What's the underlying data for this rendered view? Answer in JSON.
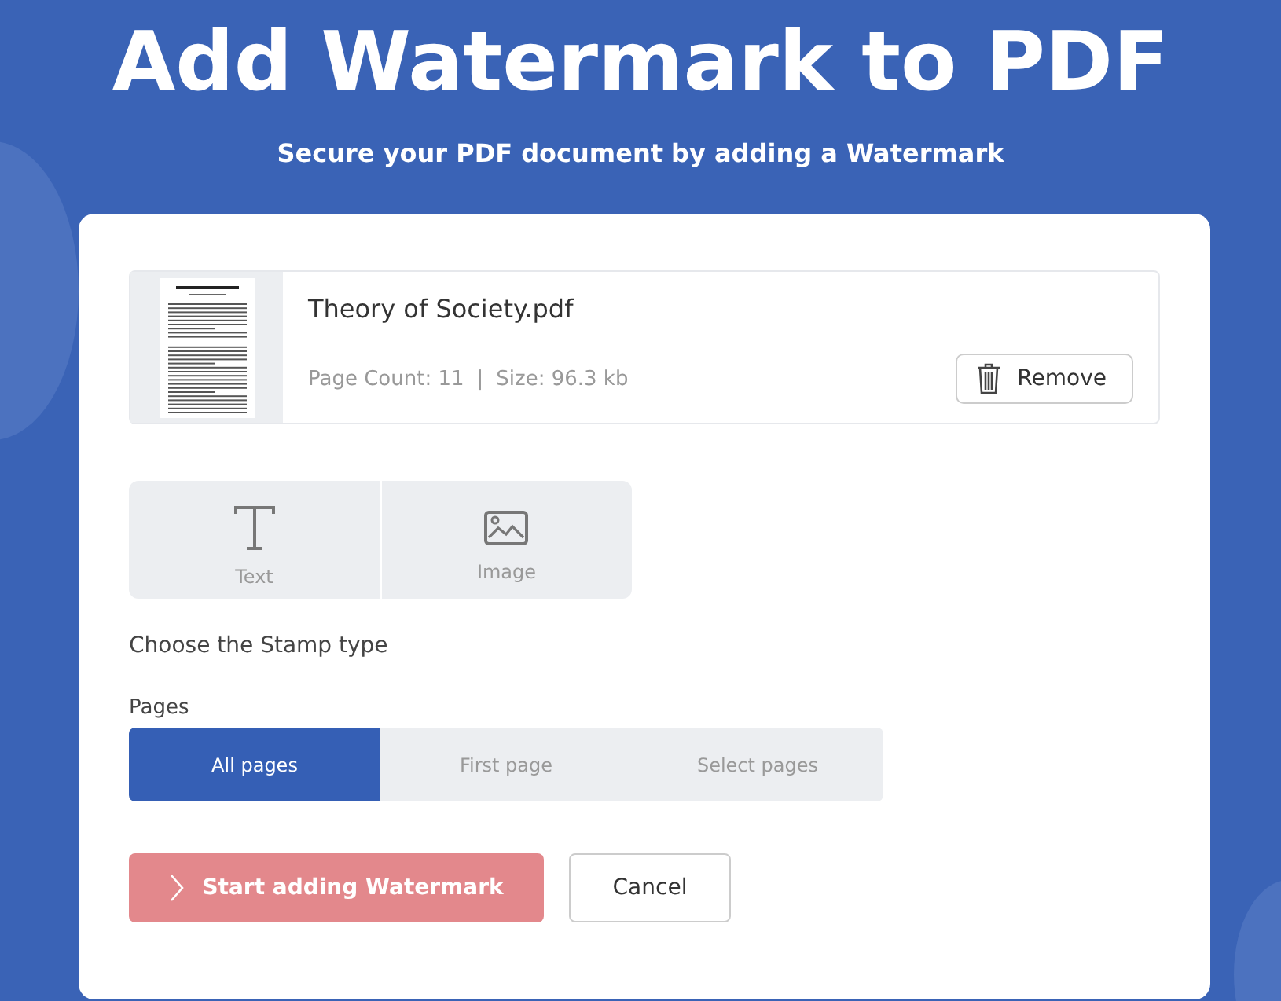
{
  "header": {
    "title": "Add Watermark to PDF",
    "subtitle": "Secure your PDF document by adding a Watermark"
  },
  "file": {
    "name": "Theory of Society.pdf",
    "page_count": "Page Count: 11",
    "separator": "|",
    "size": "Size: 96.3 kb",
    "remove_label": "Remove"
  },
  "stamp_types": [
    {
      "label": "Text",
      "kind": "text",
      "selected": false
    },
    {
      "label": "Image",
      "kind": "image",
      "selected": false
    }
  ],
  "stamp_hint": "Choose the Stamp type",
  "pages_label": "Pages",
  "pages_options": [
    {
      "label": "All pages",
      "selected": true
    },
    {
      "label": "First page",
      "selected": false
    },
    {
      "label": "Select pages",
      "selected": false
    }
  ],
  "start_button": {
    "label": "Start adding Watermark",
    "disabled": true
  },
  "cancel_button": {
    "label": "Cancel"
  }
}
